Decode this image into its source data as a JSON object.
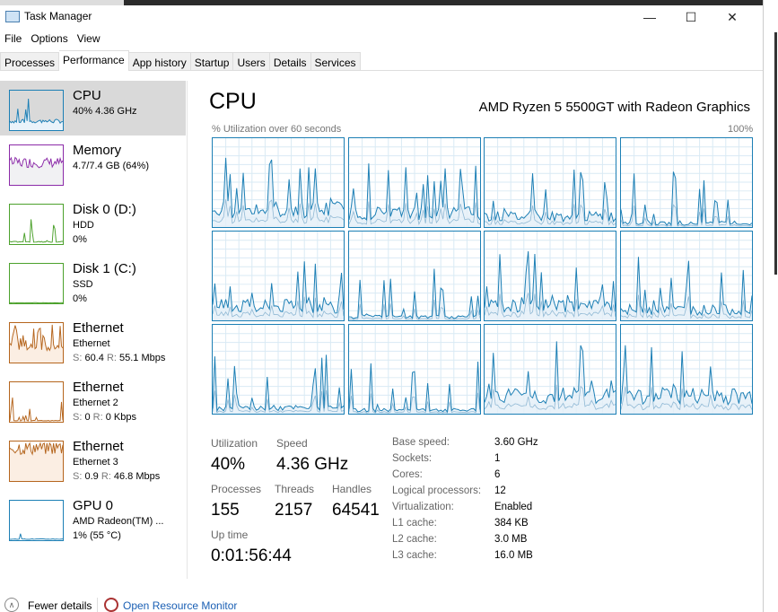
{
  "window": {
    "title": "Task Manager",
    "minimize": "—",
    "maximize": "☐",
    "close": "✕"
  },
  "menu": [
    "File",
    "Options",
    "View"
  ],
  "tabs": [
    "Processes",
    "Performance",
    "App history",
    "Startup",
    "Users",
    "Details",
    "Services"
  ],
  "active_tab": "Performance",
  "sidebar": [
    {
      "name": "CPU",
      "line1": "40% 4.36 GHz",
      "color": "#1c7fb5"
    },
    {
      "name": "Memory",
      "line1": "4.7/7.4 GB (64%)",
      "color": "#8b2aa8"
    },
    {
      "name": "Disk 0 (D:)",
      "line1": "HDD",
      "line2": "0%",
      "color": "#4ca12c"
    },
    {
      "name": "Disk 1 (C:)",
      "line1": "SSD",
      "line2": "0%",
      "color": "#4ca12c"
    },
    {
      "name": "Ethernet",
      "line1": "Ethernet",
      "s_label": "S:",
      "s": "60.4",
      "r_label": "R:",
      "r": "55.1 Mbps",
      "color": "#b5651d"
    },
    {
      "name": "Ethernet",
      "line1": "Ethernet 2",
      "s_label": "S:",
      "s": "0",
      "r_label": "R:",
      "r": "0 Kbps",
      "color": "#b5651d"
    },
    {
      "name": "Ethernet",
      "line1": "Ethernet 3",
      "s_label": "S:",
      "s": "0.9",
      "r_label": "R:",
      "r": "46.8 Mbps",
      "color": "#b5651d"
    },
    {
      "name": "GPU 0",
      "line1": "AMD Radeon(TM) ...",
      "line2": "1% (55 °C)",
      "color": "#1c7fb5"
    }
  ],
  "main": {
    "title": "CPU",
    "model": "AMD Ryzen 5 5500GT with Radeon Graphics",
    "graph_label": "% Utilization over 60 seconds",
    "graph_max": "100%",
    "logical_graphs": 12,
    "stats": {
      "utilization_label": "Utilization",
      "utilization": "40%",
      "speed_label": "Speed",
      "speed": "4.36 GHz",
      "processes_label": "Processes",
      "processes": "155",
      "threads_label": "Threads",
      "threads": "2157",
      "handles_label": "Handles",
      "handles": "64541",
      "uptime_label": "Up time",
      "uptime": "0:01:56:44"
    },
    "specs": [
      [
        "Base speed:",
        "3.60 GHz"
      ],
      [
        "Sockets:",
        "1"
      ],
      [
        "Cores:",
        "6"
      ],
      [
        "Logical processors:",
        "12"
      ],
      [
        "Virtualization:",
        "Enabled"
      ],
      [
        "L1 cache:",
        "384 KB"
      ],
      [
        "L2 cache:",
        "3.0 MB"
      ],
      [
        "L3 cache:",
        "16.0 MB"
      ]
    ]
  },
  "footer": {
    "fewer": "Fewer details",
    "resource_monitor": "Open Resource Monitor"
  }
}
